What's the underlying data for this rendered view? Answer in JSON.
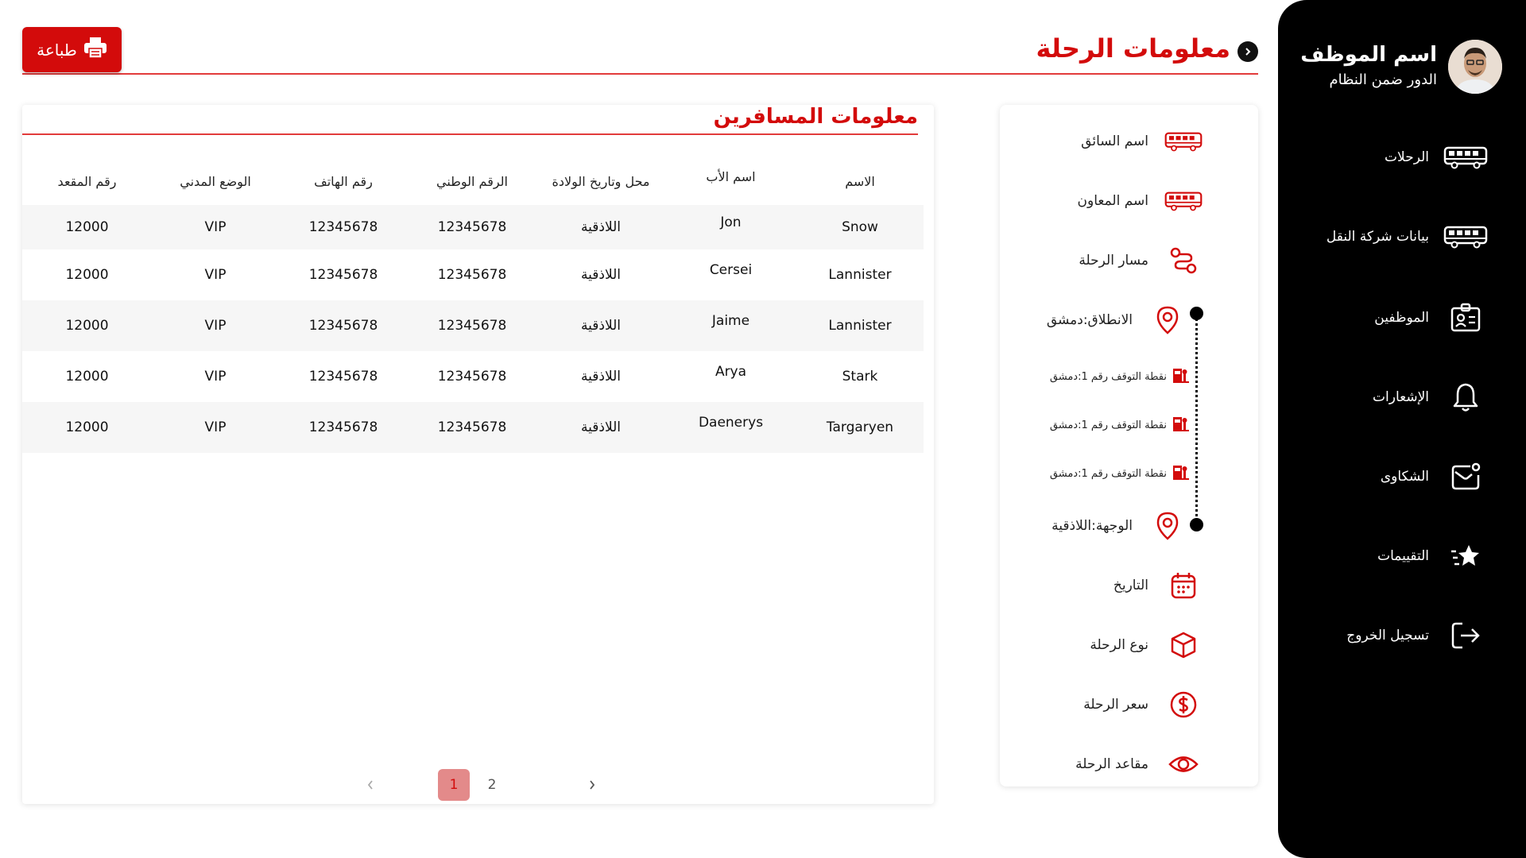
{
  "profile": {
    "name": "اسم الموظف",
    "role": "الدور ضمن النظام"
  },
  "sidebar": {
    "items": [
      {
        "label": "الرحلات",
        "icon": "bus-icon"
      },
      {
        "label": "بيانات شركة النقل",
        "icon": "bus-icon"
      },
      {
        "label": "الموظفين",
        "icon": "id-badge-icon"
      },
      {
        "label": "الإشعارات",
        "icon": "bell-icon"
      },
      {
        "label": "الشكاوى",
        "icon": "mail-icon"
      },
      {
        "label": "التقييمات",
        "icon": "star-icon"
      },
      {
        "label": "تسجيل الخروج",
        "icon": "logout-icon"
      }
    ]
  },
  "header": {
    "title": "معلومات الرحلة",
    "print_label": "طباعة"
  },
  "trip": {
    "driver": "اسم السائق",
    "assistant": "اسم المعاون",
    "route": "مسار الرحلة",
    "departure": "الانطلاق:دمشق",
    "stops": [
      "نقطة التوقف رقم 1:دمشق",
      "نقطة التوقف رقم 1:دمشق",
      "نقطة التوقف رقم 1:دمشق"
    ],
    "destination": "الوجهة:اللاذقية",
    "date": "التاريخ",
    "type": "نوع الرحلة",
    "price": "سعر الرحلة",
    "seats": "مقاعد الرحلة"
  },
  "passengers": {
    "title": "معلومات المسافرين",
    "columns": [
      "الاسم",
      "اسم الأب",
      "محل وتاريخ الولادة",
      "الرقم الوطني",
      "رقم الهاتف",
      "الوضع المدني",
      "رقم المقعد"
    ],
    "rows": [
      [
        "Snow",
        "Jon",
        "اللاذقية",
        "12345678",
        "12345678",
        "VIP",
        "12000"
      ],
      [
        "Lannister",
        "Cersei",
        "اللاذقية",
        "12345678",
        "12345678",
        "VIP",
        "12000"
      ],
      [
        "Lannister",
        "Jaime",
        "اللاذقية",
        "12345678",
        "12345678",
        "VIP",
        "12000"
      ],
      [
        "Stark",
        "Arya",
        "اللاذقية",
        "12345678",
        "12345678",
        "VIP",
        "12000"
      ],
      [
        "Targaryen",
        "Daenerys",
        "اللاذقية",
        "12345678",
        "12345678",
        "VIP",
        "12000"
      ]
    ]
  },
  "pagination": {
    "pages": [
      "1",
      "2"
    ],
    "current": "1"
  },
  "colors": {
    "accent": "#d30b0b",
    "sidebar": "#000000",
    "row_alt": "#f6f6f6"
  }
}
